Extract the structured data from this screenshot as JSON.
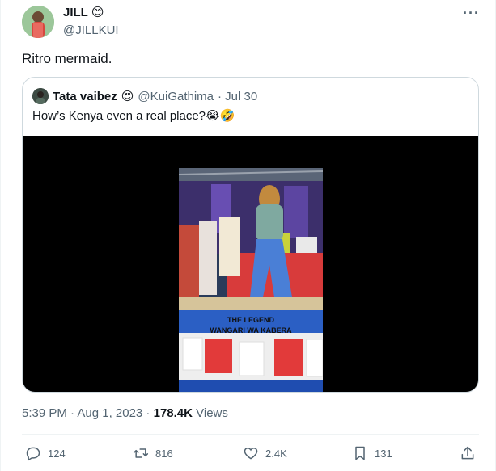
{
  "author": {
    "name": "JILL",
    "name_emoji": "😊",
    "handle": "@JILLKUI"
  },
  "more_glyph": "···",
  "tweet_text": "Ritro mermaid.",
  "quoted": {
    "name": "Tata vaibez",
    "name_emoji": "😍",
    "handle": "@KuiGathima",
    "date": "· Jul 30",
    "text": "How’s Kenya even a real place?😭🤣",
    "video_caption_line1": "THE LEGEND",
    "video_caption_line2": "WANGARI WA KABERA"
  },
  "meta": {
    "time": "5:39 PM · Aug 1, 2023 · ",
    "views_count": "178.4K",
    "views_label": " Views"
  },
  "actions": {
    "replies": "124",
    "retweets": "816",
    "likes": "2.4K",
    "bookmarks": "131"
  },
  "colors": {
    "muted": "#536471",
    "text": "#0f1419",
    "border": "#cfd9de",
    "separator": "#eff3f4"
  }
}
